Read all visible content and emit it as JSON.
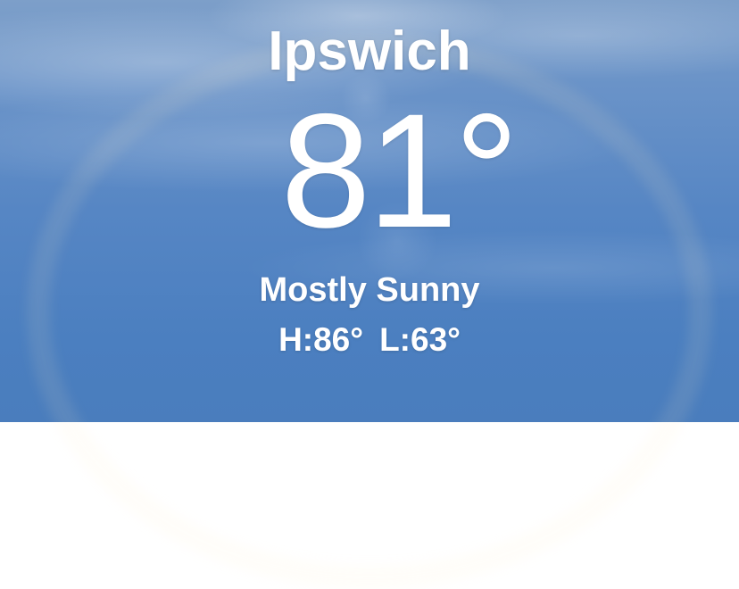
{
  "weather": {
    "city": "Ipswich",
    "temperature": "81°",
    "condition": "Mostly Sunny",
    "high": "H:86°",
    "low": "L:63°"
  },
  "background": {
    "sky_top": "#7d9fc9",
    "sky_bottom": "#4a7dbd"
  }
}
